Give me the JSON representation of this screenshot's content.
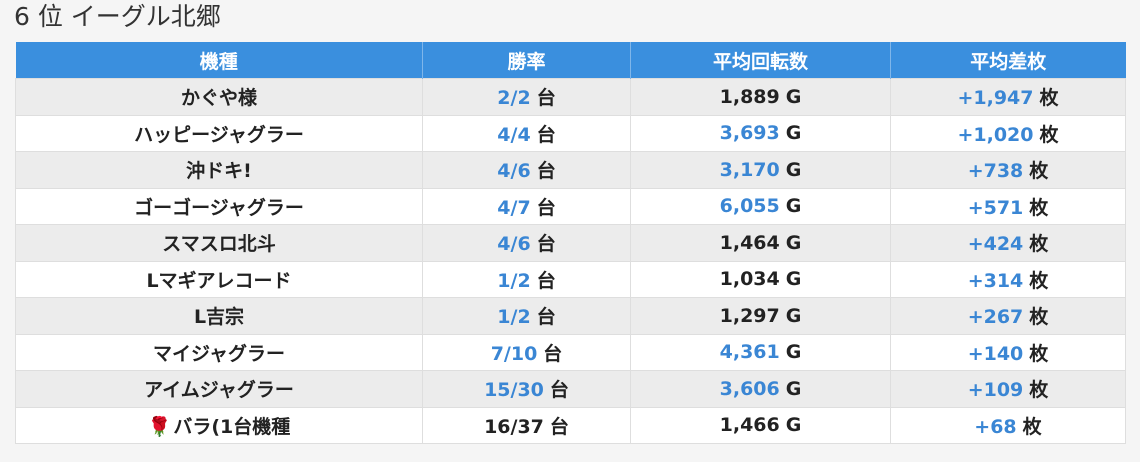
{
  "page": {
    "title": "6 位 イーグル北郷"
  },
  "table": {
    "headers": [
      "機種",
      "勝率",
      "平均回転数",
      "平均差枚"
    ],
    "rows": [
      {
        "machine": "かぐや様",
        "win": "2/2",
        "win_unit": "台",
        "spins": "1,889",
        "spins_unit": "G",
        "diff": "+1,947",
        "diff_unit": "枚",
        "win_hl": true,
        "spins_hl": false,
        "diff_hl": true
      },
      {
        "machine": "ハッピージャグラー",
        "win": "4/4",
        "win_unit": "台",
        "spins": "3,693",
        "spins_unit": "G",
        "diff": "+1,020",
        "diff_unit": "枚",
        "win_hl": true,
        "spins_hl": true,
        "diff_hl": true
      },
      {
        "machine": "沖ドキ!",
        "win": "4/6",
        "win_unit": "台",
        "spins": "3,170",
        "spins_unit": "G",
        "diff": "+738",
        "diff_unit": "枚",
        "win_hl": true,
        "spins_hl": true,
        "diff_hl": true
      },
      {
        "machine": "ゴーゴージャグラー",
        "win": "4/7",
        "win_unit": "台",
        "spins": "6,055",
        "spins_unit": "G",
        "diff": "+571",
        "diff_unit": "枚",
        "win_hl": true,
        "spins_hl": true,
        "diff_hl": true
      },
      {
        "machine": "スマスロ北斗",
        "win": "4/6",
        "win_unit": "台",
        "spins": "1,464",
        "spins_unit": "G",
        "diff": "+424",
        "diff_unit": "枚",
        "win_hl": true,
        "spins_hl": false,
        "diff_hl": true
      },
      {
        "machine": "Lマギアレコード",
        "win": "1/2",
        "win_unit": "台",
        "spins": "1,034",
        "spins_unit": "G",
        "diff": "+314",
        "diff_unit": "枚",
        "win_hl": true,
        "spins_hl": false,
        "diff_hl": true
      },
      {
        "machine": "L吉宗",
        "win": "1/2",
        "win_unit": "台",
        "spins": "1,297",
        "spins_unit": "G",
        "diff": "+267",
        "diff_unit": "枚",
        "win_hl": true,
        "spins_hl": false,
        "diff_hl": true
      },
      {
        "machine": "マイジャグラー",
        "win": "7/10",
        "win_unit": "台",
        "spins": "4,361",
        "spins_unit": "G",
        "diff": "+140",
        "diff_unit": "枚",
        "win_hl": true,
        "spins_hl": true,
        "diff_hl": true
      },
      {
        "machine": "アイムジャグラー",
        "win": "15/30",
        "win_unit": "台",
        "spins": "3,606",
        "spins_unit": "G",
        "diff": "+109",
        "diff_unit": "枚",
        "win_hl": true,
        "spins_hl": true,
        "diff_hl": true
      },
      {
        "machine": "バラ(1台機種",
        "icon": "rose-icon",
        "icon_glyph": "🌹",
        "win": "16/37",
        "win_unit": "台",
        "spins": "1,466",
        "spins_unit": "G",
        "diff": "+68",
        "diff_unit": "枚",
        "win_hl": false,
        "spins_hl": false,
        "diff_hl": true
      }
    ]
  },
  "colors": {
    "header_bg": "#3a8fde",
    "highlight": "#3a86d4",
    "row_alt": "#ececec"
  }
}
